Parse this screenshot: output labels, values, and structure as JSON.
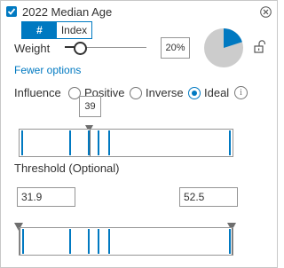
{
  "header": {
    "title": "2022 Median Age",
    "checked": true
  },
  "mode_toggle": {
    "options": [
      "#",
      "Index"
    ],
    "selected": "#"
  },
  "weight": {
    "label": "Weight",
    "value_text": "20%",
    "value": 0.2
  },
  "options_link": "Fewer options",
  "influence": {
    "label": "Influence",
    "options": [
      "Positive",
      "Inverse",
      "Ideal"
    ],
    "selected": "Ideal"
  },
  "ideal_value": "39",
  "threshold": {
    "label": "Threshold (Optional)",
    "min_value": "31.9",
    "max_value": "52.5"
  },
  "colors": {
    "accent": "#0079c1",
    "pie_fill": "#0079c1",
    "pie_bg": "#cccccc"
  },
  "icons": {
    "close": "close-icon",
    "lock": "unlock-icon",
    "info": "info-icon"
  }
}
